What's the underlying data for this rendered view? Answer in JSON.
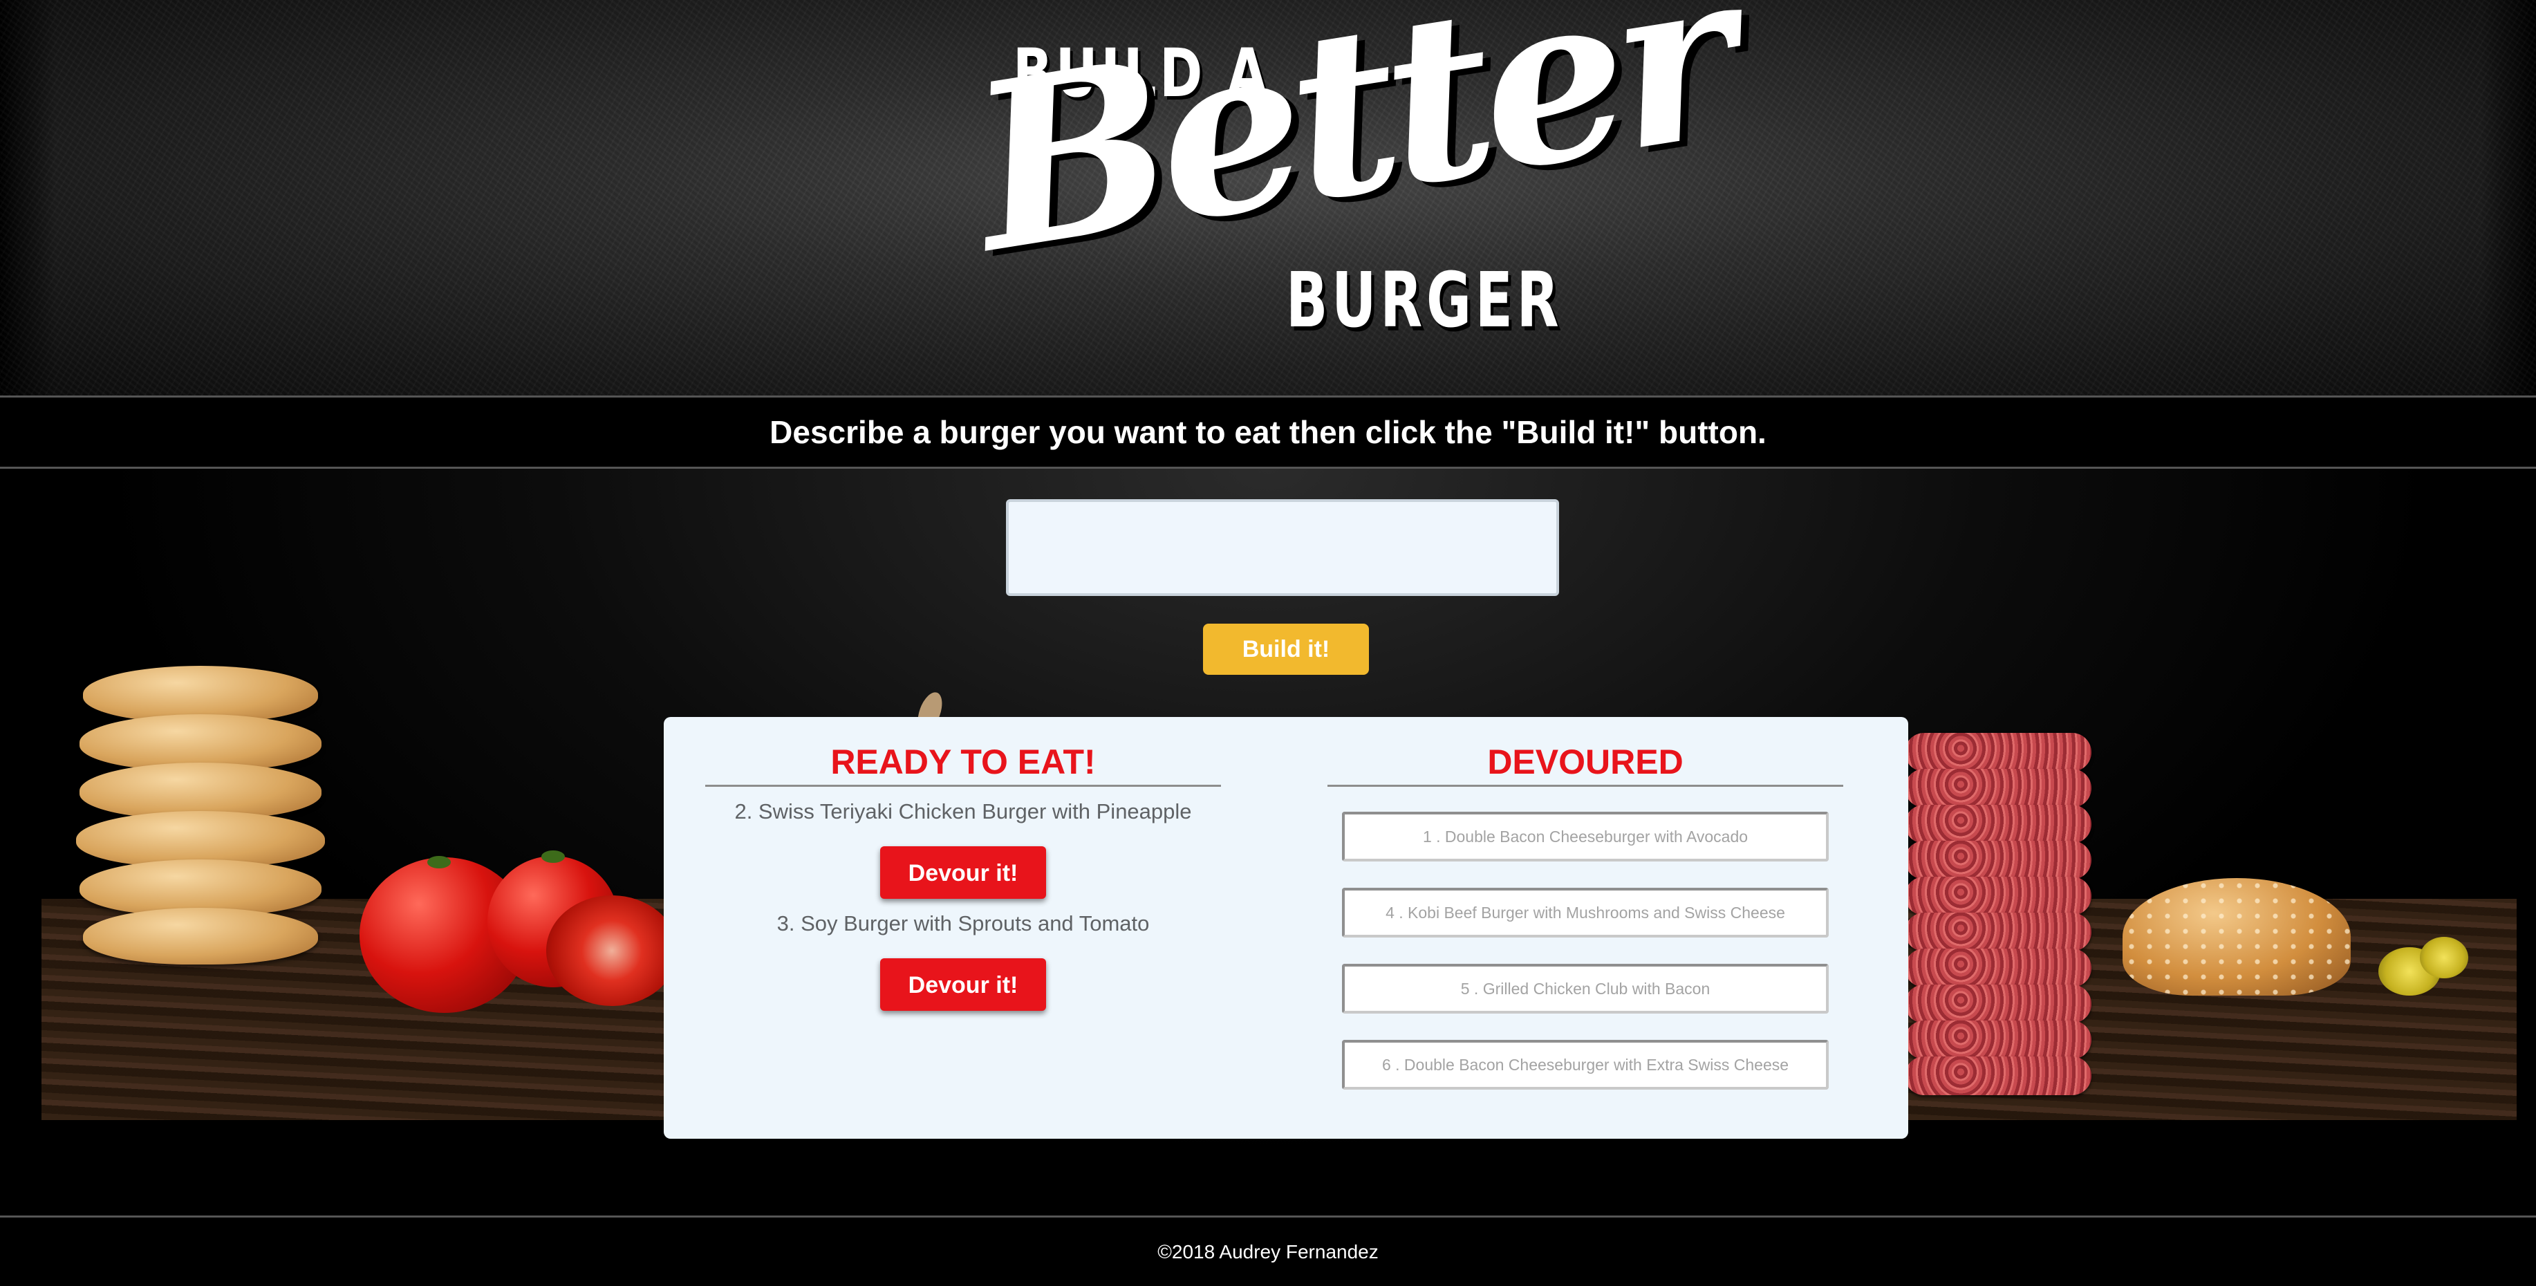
{
  "header": {
    "logo_text_top": "BUILD A",
    "logo_text_script": "Better",
    "logo_text_bottom": "BURGER",
    "instructions": "Describe a burger you want to eat then click the \"Build it!\" button."
  },
  "form": {
    "input_value": "",
    "input_placeholder": "",
    "build_button_label": "Build it!"
  },
  "ready": {
    "heading": "READY TO EAT!",
    "items": [
      {
        "text": "2. Swiss Teriyaki Chicken Burger with Pineapple",
        "button_label": "Devour it!"
      },
      {
        "text": "3. Soy Burger with Sprouts and Tomato",
        "button_label": "Devour it!"
      }
    ]
  },
  "devoured": {
    "heading": "DEVOURED",
    "items": [
      "1 . Double Bacon Cheeseburger with Avocado",
      "4 . Kobi Beef Burger with Mushrooms and Swiss Cheese",
      "5 . Grilled Chicken Club with Bacon",
      "6 . Double Bacon Cheeseburger with Extra Swiss Cheese"
    ]
  },
  "footer": {
    "text": "©2018 Audrey Fernandez"
  },
  "colors": {
    "accent_red": "#e8141b",
    "button_yellow": "#f2b92e",
    "card_background": "#eef6fc"
  }
}
